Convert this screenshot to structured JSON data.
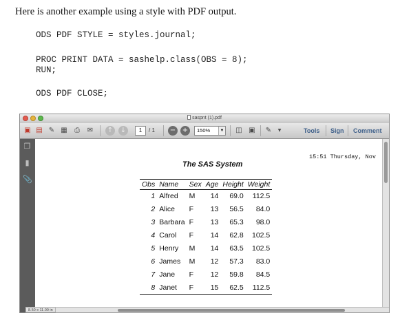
{
  "intro": "Here is another example using a style with PDF output.",
  "code": [
    "ODS PDF STYLE = styles.journal;",
    "PROC PRINT DATA = sashelp.class(OBS = 8);",
    "RUN;",
    "ODS PDF CLOSE;"
  ],
  "viewer": {
    "title": "saspnt (1).pdf",
    "toolbar": {
      "page_value": "1",
      "page_total": "/ 1",
      "zoom": "150%",
      "tools": "Tools",
      "sign": "Sign",
      "comment": "Comment"
    },
    "page_size": "8.50 x 11.00 in"
  },
  "report": {
    "timestamp": "15:51 Thursday, Nov",
    "title": "The SAS System",
    "columns": [
      "Obs",
      "Name",
      "Sex",
      "Age",
      "Height",
      "Weight"
    ],
    "rows": [
      [
        "1",
        "Alfred",
        "M",
        "14",
        "69.0",
        "112.5"
      ],
      [
        "2",
        "Alice",
        "F",
        "13",
        "56.5",
        "84.0"
      ],
      [
        "3",
        "Barbara",
        "F",
        "13",
        "65.3",
        "98.0"
      ],
      [
        "4",
        "Carol",
        "F",
        "14",
        "62.8",
        "102.5"
      ],
      [
        "5",
        "Henry",
        "M",
        "14",
        "63.5",
        "102.5"
      ],
      [
        "6",
        "James",
        "M",
        "12",
        "57.3",
        "83.0"
      ],
      [
        "7",
        "Jane",
        "F",
        "12",
        "59.8",
        "84.5"
      ],
      [
        "8",
        "Janet",
        "F",
        "15",
        "62.5",
        "112.5"
      ]
    ]
  },
  "icons": {
    "traffic_lights": [
      "close",
      "minimize",
      "maximize"
    ],
    "toolbar": [
      "create-pdf-icon",
      "open-icon",
      "edit-icon",
      "save-icon",
      "print-icon",
      "email-icon",
      "prev-page-icon",
      "next-page-icon",
      "zoom-out-icon",
      "zoom-in-icon",
      "fit-width-icon",
      "full-screen-icon",
      "annotate-icon"
    ],
    "sidebar": [
      "pages-icon",
      "bookmarks-icon",
      "attachments-icon"
    ]
  }
}
